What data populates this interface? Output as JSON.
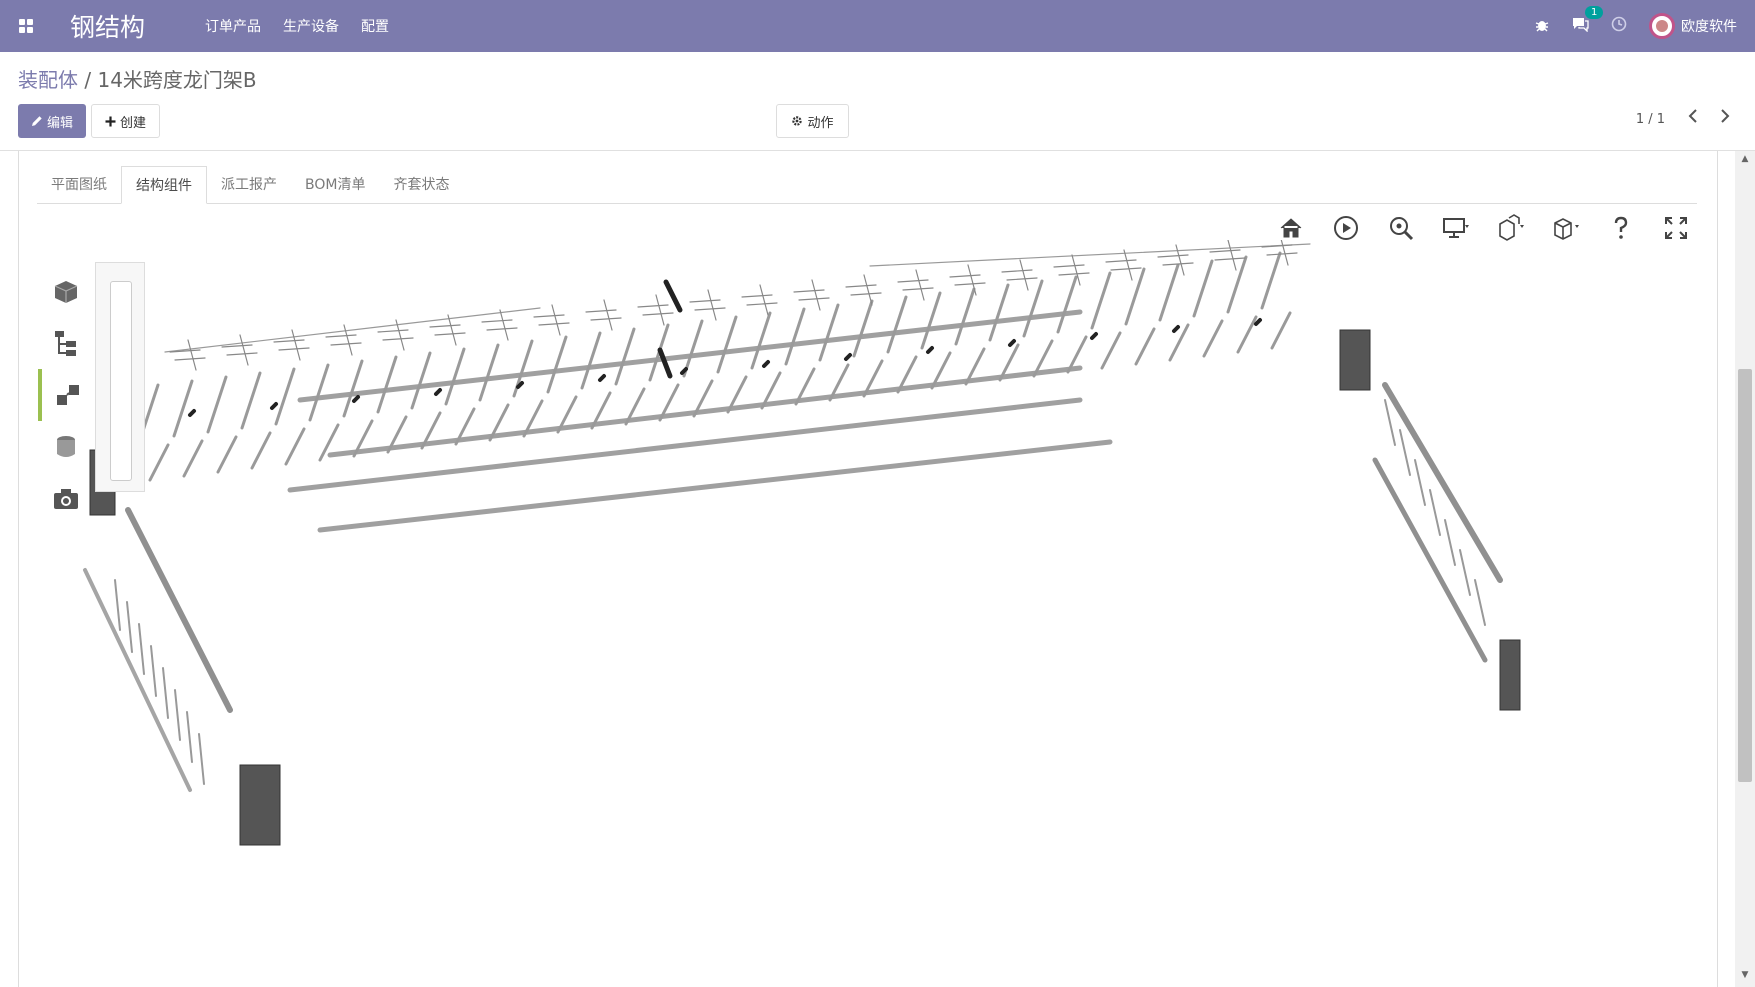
{
  "app": {
    "brand": "钢结构",
    "menu": [
      "订单产品",
      "生产设备",
      "配置"
    ],
    "notifications_count": "1",
    "user_name": "欧度软件"
  },
  "breadcrumb": {
    "parent": "装配体",
    "separator": "/",
    "current": "14米跨度龙门架B"
  },
  "buttons": {
    "edit": "编辑",
    "create": "创建",
    "action": "动作"
  },
  "pager": {
    "value": "1 / 1"
  },
  "tabs": [
    "平面图纸",
    "结构组件",
    "派工报产",
    "BOM清单",
    "齐套状态"
  ],
  "active_tab_index": 1,
  "colors": {
    "navbar": "#7c7bad",
    "primary_button": "#7c7bad",
    "badge": "#00a09d",
    "active_side_tool": "#9bc050"
  },
  "viewer": {
    "toolbar_icons": [
      "home-icon",
      "play-icon",
      "zoom-fit-icon",
      "display-icon",
      "explode-icon",
      "view-cube-icon",
      "help-icon",
      "fullscreen-icon"
    ],
    "side_tools": [
      "model-tree-icon",
      "structure-tree-icon",
      "explode-tool-icon",
      "section-tool-icon",
      "camera-icon"
    ],
    "active_side_tool_index": 2
  }
}
